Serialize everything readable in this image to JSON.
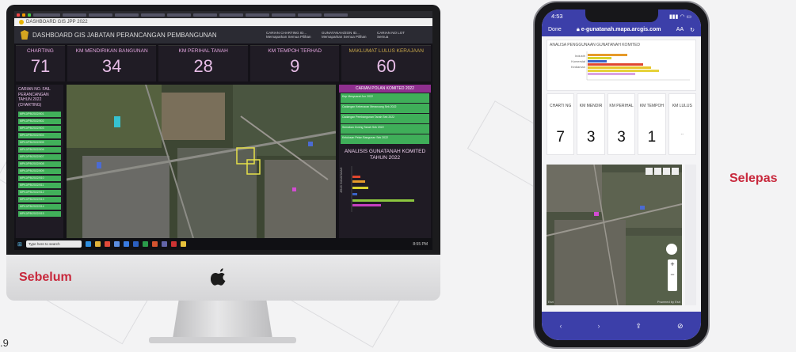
{
  "page_number": ".9",
  "labels": {
    "before": "Sebelum",
    "after": "Selepas"
  },
  "colors": {
    "label_red": "#c8283c",
    "kpi_pink": "#e7bde7",
    "green": "#3fae59",
    "phone_blue": "#3c3fa9"
  },
  "desktop": {
    "dashboard_title": "DASHBOARD GIS JABATAN PERANCANGAN PEMBANGUNAN",
    "header_fields": [
      {
        "label": "CARIAN CHARTING ID...",
        "value": "Memaparkan Semua Pilihan"
      },
      {
        "label": "GUNATANAH/ZON ID...",
        "value": "Memaparkan Semua Pilihan"
      },
      {
        "label": "CARIAN NO LOT",
        "value": "Semua"
      }
    ],
    "kpis": [
      {
        "label": "CHARTING",
        "value": "71"
      },
      {
        "label": "KM MENDIRIKAN BANGUNAN",
        "value": "34"
      },
      {
        "label": "KM PERIHAL TANAH",
        "value": "28"
      },
      {
        "label": "KM TEMPOH TERHAD",
        "value": "9"
      },
      {
        "label": "MAKLUMAT LULUS KERAJAAN",
        "value": "60"
      }
    ],
    "left_panel_title": "CARIAN NO. FAIL PERANCANGAN TAHUN 2022 (CHARTING)",
    "left_items": [
      "MPKJ/PB/2022/001",
      "MPKJ/PB/2022/002",
      "MPKJ/PB/2022/003",
      "MPKJ/PB/2022/004",
      "MPKJ/PB/2022/005",
      "MPKJ/PB/2022/006",
      "MPKJ/PB/2022/007",
      "MPKJ/PB/2022/008",
      "MPKJ/PB/2022/009",
      "MPKJ/PB/2022/010",
      "MPKJ/PB/2022/011",
      "MPKJ/PB/2022/012",
      "MPKJ/PB/2022/013",
      "MPKJ/PB/2022/014",
      "MPKJ/PB/2022/015"
    ],
    "right_panel_title": "CARIAN POLAN KOMITED 2022",
    "right_items": [
      "Kep Mesyuarat Jun 2022",
      "Cadangan Kebenaran Merancang Sek 2022",
      "Cadangan Pembangunan Tanah Sek 2022",
      "Semakan Zoning Tanah Sek 2022",
      "Kelulusan Pelan Bangunan Sek 2022"
    ],
    "chart_title": "ANALISIS GUNATANAH KOMITED TAHUN 2022",
    "chart_ylabel": "JENIS GUNATANAH",
    "taskbar_search": "Type here to search",
    "taskbar_time": "8:55 PM"
  },
  "mobile": {
    "status_time": "4:53",
    "done_label": "Done",
    "url": "e-gunatanah.mapa.arcgis.com",
    "text_size_label": "AA",
    "chart_title": "ANALISA PENGGUNAAN GUNATANAH KOMITED",
    "chart_categories": [
      "Industri",
      "Komersial",
      "Kediaman"
    ],
    "kpis": [
      {
        "label": "CHARTI NG",
        "value": "7"
      },
      {
        "label": "KM MENDIR",
        "value": "3"
      },
      {
        "label": "KM PERIHAL",
        "value": "3"
      },
      {
        "label": "KM TEMPOH",
        "value": "1"
      },
      {
        "label": "KM LULUS",
        "value": "--"
      }
    ],
    "map_credit_left": "Esri",
    "map_credit_right": "Powered by Esri"
  }
}
